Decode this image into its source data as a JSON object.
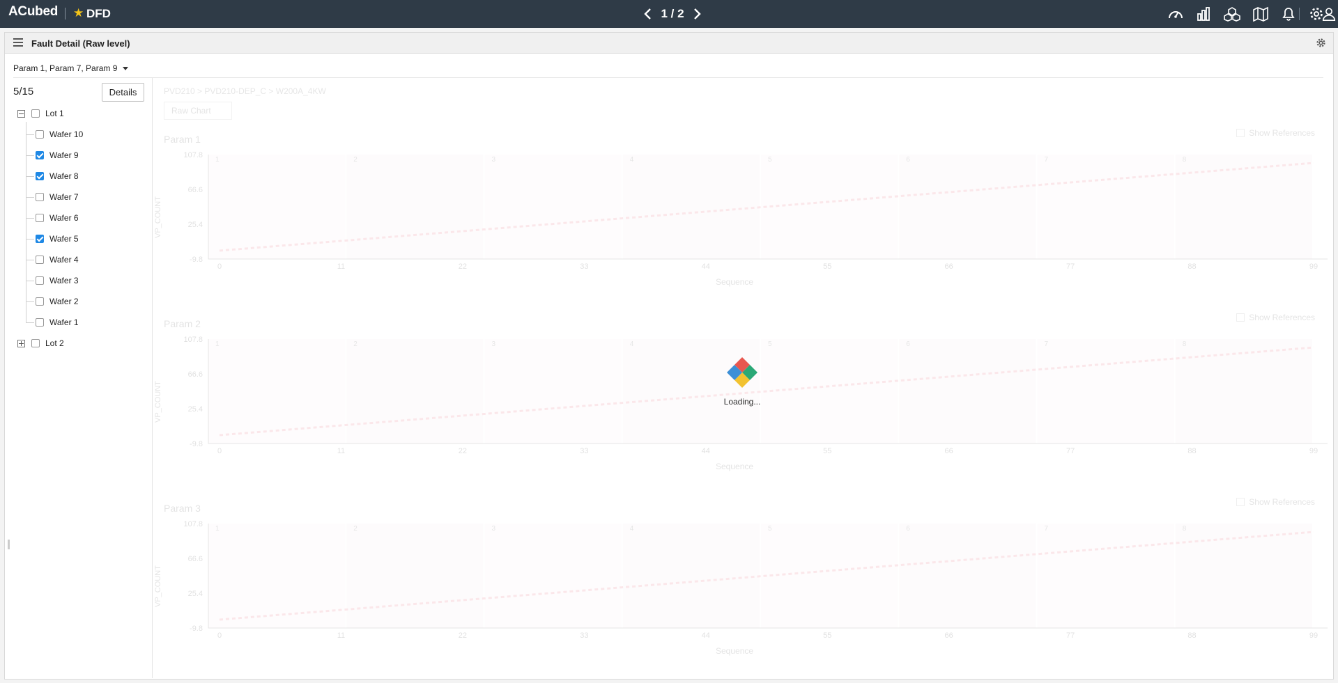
{
  "header": {
    "brand": "ACubed",
    "app_name": "DFD",
    "pager": "1 / 2",
    "icons": [
      "dashboard-icon",
      "bar-chart-icon",
      "cubes-icon",
      "map-icon",
      "bell-icon",
      "gear-icon",
      "user-icon"
    ],
    "bg_color": "#2f3b47",
    "star_color": "#f5c518"
  },
  "panel": {
    "title": "Fault Detail (Raw level)",
    "param_select": "Param 1, Param 7, Param 9"
  },
  "sidebar": {
    "count": "5/15",
    "details_label": "Details",
    "lots": [
      {
        "label": "Lot 1",
        "expanded": true,
        "checked": false,
        "wafers": [
          {
            "label": "Wafer 10",
            "checked": false
          },
          {
            "label": "Wafer 9",
            "checked": true
          },
          {
            "label": "Wafer 8",
            "checked": true
          },
          {
            "label": "Wafer 7",
            "checked": false
          },
          {
            "label": "Wafer 6",
            "checked": false
          },
          {
            "label": "Wafer 5",
            "checked": true
          },
          {
            "label": "Wafer 4",
            "checked": false
          },
          {
            "label": "Wafer 3",
            "checked": false
          },
          {
            "label": "Wafer 2",
            "checked": false
          },
          {
            "label": "Wafer 1",
            "checked": false
          }
        ]
      },
      {
        "label": "Lot 2",
        "expanded": false,
        "checked": false,
        "wafers": []
      }
    ]
  },
  "content": {
    "breadcrumb": "PVD210 > PVD210-DEP_C > W200A_4KW",
    "chart_type_label": "Raw Chart",
    "show_references_label": "Show References",
    "charts": [
      {
        "name": "Param 1",
        "ylabel": "VP_COUNT",
        "xlabel": "Sequence"
      },
      {
        "name": "Param 2",
        "ylabel": "VP_COUNT",
        "xlabel": "Sequence"
      },
      {
        "name": "Param 3",
        "ylabel": "VP_COUNT",
        "xlabel": "Sequence"
      }
    ],
    "y_ticks": [
      "107.8",
      "66.6",
      "25.4",
      "-9.8"
    ],
    "x_ticks": [
      "0",
      "11",
      "22",
      "33",
      "44",
      "55",
      "66",
      "77",
      "88",
      "99"
    ],
    "band_labels": [
      "1",
      "2",
      "3",
      "4",
      "5",
      "6",
      "7",
      "8"
    ]
  },
  "loading": {
    "text": "Loading...",
    "colors": [
      "#e8574f",
      "#2aa876",
      "#f2c230",
      "#3c8fd6"
    ]
  }
}
